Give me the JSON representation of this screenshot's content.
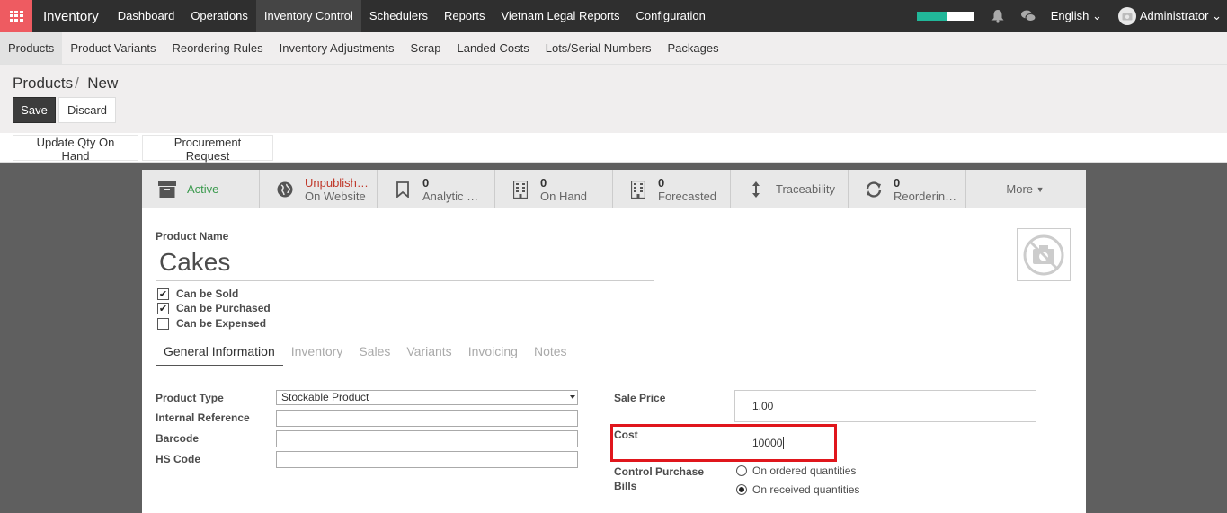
{
  "app": {
    "name": "Inventory"
  },
  "topmenu": [
    "Dashboard",
    "Operations",
    "Inventory Control",
    "Schedulers",
    "Reports",
    "Vietnam Legal Reports",
    "Configuration"
  ],
  "topmenu_active": "Inventory Control",
  "topright": {
    "progress_percent": 55,
    "language": "English",
    "user": "Administrator"
  },
  "submenu": [
    "Products",
    "Product Variants",
    "Reordering Rules",
    "Inventory Adjustments",
    "Scrap",
    "Landed Costs",
    "Lots/Serial Numbers",
    "Packages"
  ],
  "submenu_active": "Products",
  "breadcrumb": {
    "parent": "Products",
    "separator": "/",
    "current": "New"
  },
  "actions": {
    "save": "Save",
    "discard": "Discard"
  },
  "header_buttons": {
    "update_qty": "Update Qty On Hand",
    "procurement": "Procurement Request"
  },
  "stats": [
    {
      "icon": "archive-icon",
      "line1": "Active",
      "line2": ""
    },
    {
      "icon": "globe-icon",
      "line1": "Unpublish…",
      "line2": "On Website"
    },
    {
      "icon": "bookmark-icon",
      "line1": "0",
      "line2": "Analytic …"
    },
    {
      "icon": "building-icon",
      "line1": "0",
      "line2": "On Hand"
    },
    {
      "icon": "building-icon",
      "line1": "0",
      "line2": "Forecasted"
    },
    {
      "icon": "arrows-vertical-icon",
      "line1": "Traceability",
      "line2": ""
    },
    {
      "icon": "refresh-icon",
      "line1": "0",
      "line2": "Reorderin…"
    },
    {
      "icon": "",
      "line1": "More",
      "line2": ""
    }
  ],
  "product": {
    "name_label": "Product Name",
    "name": "Cakes",
    "checkboxes": [
      {
        "label": "Can be Sold",
        "checked": true
      },
      {
        "label": "Can be Purchased",
        "checked": true
      },
      {
        "label": "Can be Expensed",
        "checked": false
      }
    ]
  },
  "tabs": [
    "General Information",
    "Inventory",
    "Sales",
    "Variants",
    "Invoicing",
    "Notes"
  ],
  "tab_active": "General Information",
  "general_left": {
    "product_type_label": "Product Type",
    "product_type": "Stockable Product",
    "internal_ref_label": "Internal Reference",
    "internal_ref": "",
    "barcode_label": "Barcode",
    "barcode": "",
    "hs_code_label": "HS Code",
    "hs_code": ""
  },
  "general_right": {
    "sale_price_label": "Sale Price",
    "sale_price": "1.00",
    "cost_label": "Cost",
    "cost": "10000",
    "control_bills_label_1": "Control Purchase",
    "control_bills_label_2": "Bills",
    "options": [
      {
        "label": "On ordered quantities",
        "selected": false
      },
      {
        "label": "On received quantities",
        "selected": true
      }
    ]
  },
  "colors": {
    "accent": "#ee5b61",
    "navbar": "#2f2f2f",
    "active_status": "#3b9a4e",
    "unpublished": "#c0392b",
    "progress": "#21b799",
    "highlight": "#e0161c"
  }
}
